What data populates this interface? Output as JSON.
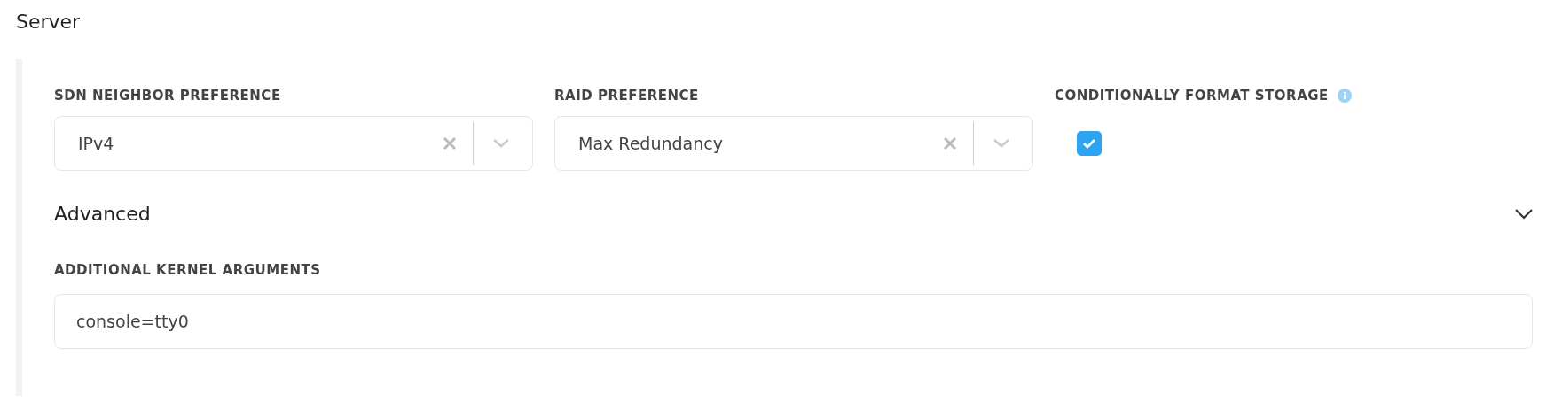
{
  "title": "Server",
  "fields": [
    {
      "kind": "select",
      "label": "SDN NEIGHBOR PREFERENCE",
      "value": "IPv4"
    },
    {
      "kind": "select",
      "label": "RAID PREFERENCE",
      "value": "Max Redundancy"
    },
    {
      "kind": "checkbox",
      "label": "CONDITIONALLY FORMAT STORAGE",
      "checked": true
    }
  ],
  "advanced": {
    "title": "Advanced",
    "expanded": true,
    "fields": [
      {
        "kind": "text",
        "label": "ADDITIONAL KERNEL ARGUMENTS",
        "value": "console=tty0"
      }
    ]
  }
}
